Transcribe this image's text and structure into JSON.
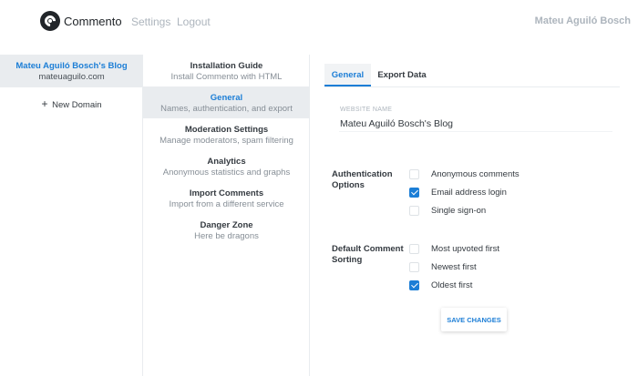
{
  "header": {
    "brand": "Commento",
    "nav": [
      "Settings",
      "Logout"
    ],
    "user_name": "Mateu Aguiló Bosch"
  },
  "domains": {
    "items": [
      {
        "name": "Mateu Aguiló Bosch's Blog",
        "url": "mateuaguilo.com",
        "selected": true
      }
    ],
    "new_domain_label": "New Domain"
  },
  "menu": {
    "items": [
      {
        "title": "Installation Guide",
        "subtitle": "Install Commento with HTML",
        "active": false
      },
      {
        "title": "General",
        "subtitle": "Names, authentication, and export",
        "active": true
      },
      {
        "title": "Moderation Settings",
        "subtitle": "Manage moderators, spam filtering",
        "active": false
      },
      {
        "title": "Analytics",
        "subtitle": "Anonymous statistics and graphs",
        "active": false
      },
      {
        "title": "Import Comments",
        "subtitle": "Import from a different service",
        "active": false
      },
      {
        "title": "Danger Zone",
        "subtitle": "Here be dragons",
        "active": false
      }
    ]
  },
  "content": {
    "tabs": [
      {
        "label": "General",
        "active": true
      },
      {
        "label": "Export Data",
        "active": false
      }
    ],
    "website_name": {
      "label": "Website Name",
      "value": "Mateu Aguiló Bosch's Blog"
    },
    "authentication": {
      "label_line1": "Authentication",
      "label_line2": "Options",
      "options": [
        {
          "label": "Anonymous comments",
          "checked": false
        },
        {
          "label": "Email address login",
          "checked": true
        },
        {
          "label": "Single sign-on",
          "checked": false
        }
      ]
    },
    "sorting": {
      "label_line1": "Default Comment",
      "label_line2": "Sorting",
      "options": [
        {
          "label": "Most upvoted first",
          "checked": false
        },
        {
          "label": "Newest first",
          "checked": false
        },
        {
          "label": "Oldest first",
          "checked": true
        }
      ]
    },
    "save_label": "Save Changes"
  },
  "colors": {
    "accent": "#1c7ed6",
    "selected_bg": "#e9ecef",
    "muted_text": "#adb5bd"
  }
}
